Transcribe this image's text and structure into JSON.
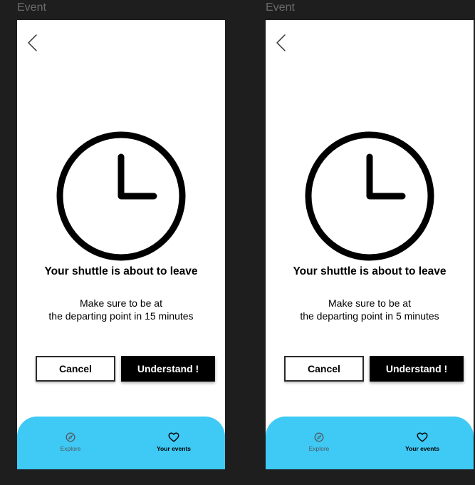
{
  "frames": [
    {
      "label": "Event",
      "title": "Your shuttle is about to leave",
      "message_line1": "Make sure to be at",
      "message_line2": "the departing point in 15 minutes",
      "cancel_label": "Cancel",
      "confirm_label": "Understand !",
      "nav": {
        "explore_label": "Explore",
        "events_label": "Your events"
      }
    },
    {
      "label": "Event",
      "title": "Your shuttle is about to leave",
      "message_line1": "Make sure to be at",
      "message_line2": "the departing point in 5 minutes",
      "cancel_label": "Cancel",
      "confirm_label": "Understand !",
      "nav": {
        "explore_label": "Explore",
        "events_label": "Your events"
      }
    }
  ],
  "icons": [
    "back-chevron-icon",
    "clock-icon",
    "compass-icon",
    "heart-icon"
  ],
  "colors": {
    "canvas": "#1e1e1e",
    "nav_bar": "#3fc9f5",
    "primary_button": "#000000"
  }
}
